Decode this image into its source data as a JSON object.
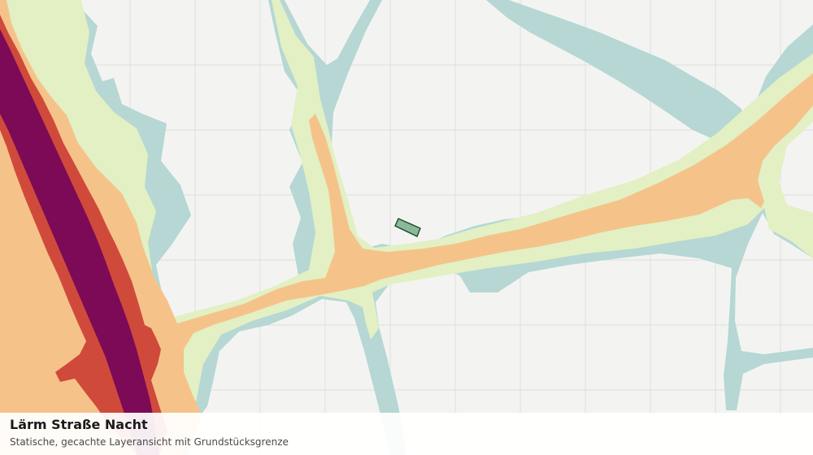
{
  "map": {
    "layer_title": "Lärm Straße Nacht",
    "subtitle": "Statische, gecachte Layeransicht mit Grundstücksgrenze",
    "colors": {
      "background": "#f3f4f2",
      "grid": "#dcdfdc",
      "band_1": "#b6d7d3",
      "band_2": "#e2f0c4",
      "band_3": "#f5c38a",
      "band_4": "#d04a3b",
      "band_5": "#7c0a57",
      "parcel_fill": "#8ab89a",
      "parcel_stroke": "#1f4a2a"
    },
    "parcel": {
      "name": "grundstuecksgrenze"
    }
  }
}
